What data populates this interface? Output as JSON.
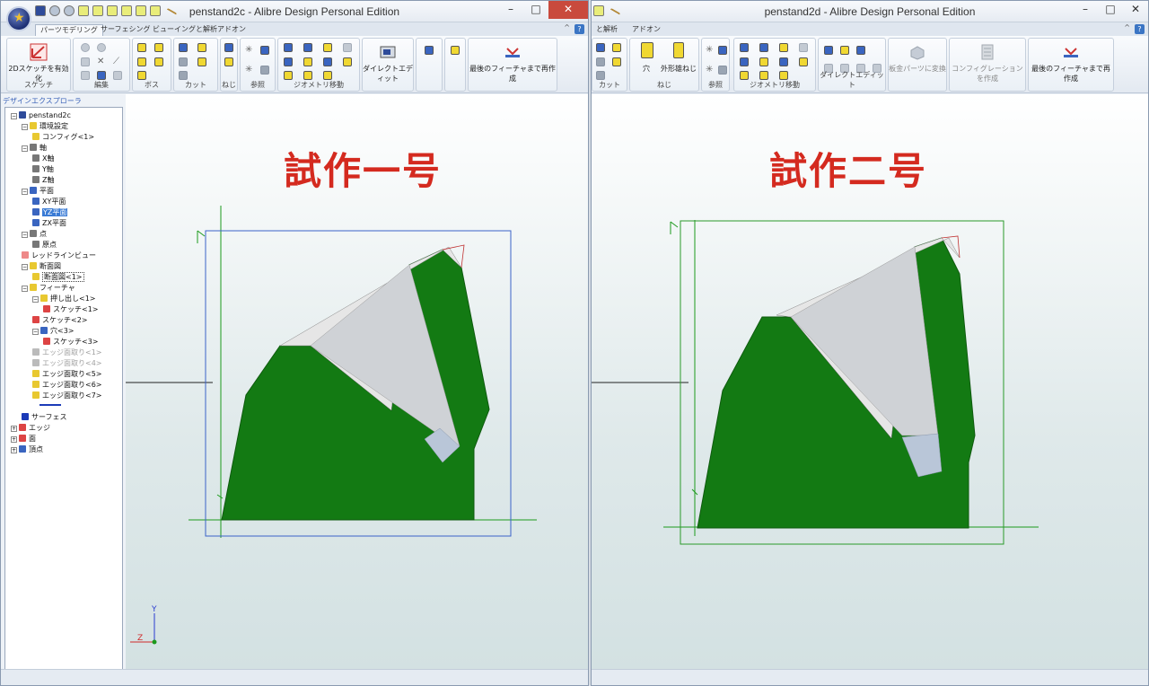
{
  "left_window": {
    "title": "penstand2c - Alibre Design Personal Edition",
    "tabs": [
      "パーツモデリング",
      "サーフェシング",
      "ビューイングと解析",
      "アドオン"
    ],
    "ribbon": {
      "sketch_button": "2Dスケッチを有効化",
      "groups": [
        "スケッチ",
        "編集",
        "ボス",
        "カット",
        "ねじ",
        "参照",
        "ジオメトリ移動"
      ],
      "direct_edit_button": "ダイレクトエディット",
      "rebuild_button": "最後のフィーチャまで再作成"
    },
    "explorer_title": "デザインエクスプローラ",
    "tree": [
      "penstand2c",
      "環境設定",
      "コンフィグ<1>",
      "軸",
      "X軸",
      "Y軸",
      "Z軸",
      "平面",
      "XY平面",
      "YZ平面",
      "ZX平面",
      "点",
      "原点",
      "レッドラインビュー",
      "断面図",
      "断面図<1>",
      "フィーチャ",
      "押し出し<1>",
      "スケッチ<1>",
      "スケッチ<2>",
      "穴<3>",
      "スケッチ<3>",
      "エッジ面取り<1>",
      "エッジ面取り<4>",
      "エッジ面取り<5>",
      "エッジ面取り<6>",
      "エッジ面取り<7>",
      "サーフェス",
      "エッジ",
      "面",
      "頂点"
    ],
    "heading": "試作一号"
  },
  "right_window": {
    "title": "penstand2d - Alibre Design Personal Edition",
    "tabs": [
      "と解析",
      "アドオン"
    ],
    "ribbon": {
      "hole_button": "穴",
      "thread_button": "外形雄ねじ",
      "groups": [
        "カット",
        "ねじ",
        "参照",
        "ジオメトリ移動",
        "ダイレクトエディット"
      ],
      "sheetmetal_button": "板金パーツに変換",
      "config_button": "コンフィグレーションを作成",
      "rebuild_button": "最後のフィーチャまで再作成"
    },
    "heading": "試作二号"
  },
  "colors": {
    "part_green": "#137a13",
    "heading_red": "#d42a1f",
    "left_bbox": "#3b63c8",
    "right_bbox": "#2a9a2a"
  },
  "icons": [
    "app-orb-icon",
    "save-icon",
    "undo-icon",
    "redo-icon",
    "close-icon",
    "minimize-icon",
    "maximize-icon",
    "help-icon",
    "axis-triad-icon"
  ]
}
